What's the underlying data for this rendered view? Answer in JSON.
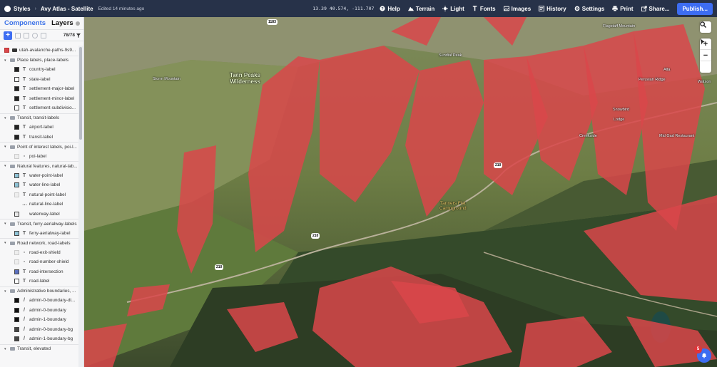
{
  "topbar": {
    "styles_label": "Styles",
    "separator": "›",
    "title": "Avy Atlas - Satellite",
    "edited": "Edited 14 minutes ago",
    "coords": "13.39  40.574, -111.707",
    "nav": [
      {
        "label": "Help",
        "icon": "help-icon"
      },
      {
        "label": "Terrain",
        "icon": "terrain-icon"
      },
      {
        "label": "Light",
        "icon": "light-icon"
      },
      {
        "label": "Fonts",
        "icon": "fonts-icon"
      },
      {
        "label": "Images",
        "icon": "images-icon"
      },
      {
        "label": "History",
        "icon": "history-icon"
      },
      {
        "label": "Settings",
        "icon": "settings-icon"
      },
      {
        "label": "Print",
        "icon": "print-icon"
      },
      {
        "label": "Share...",
        "icon": "share-icon"
      }
    ],
    "publish": "Publish..."
  },
  "sidebar": {
    "tab_components": "Components",
    "tab_layers": "Layers",
    "layer_count": "78/78",
    "root_layer": "utah-avalanche-paths-9s9...",
    "groups": [
      {
        "name": "Place labels, place-labels",
        "items": [
          {
            "label": "country-label",
            "color": "#222222",
            "type": "T"
          },
          {
            "label": "state-label",
            "color": "#ffffff",
            "type": "T"
          },
          {
            "label": "settlement-major-label",
            "color": "#222222",
            "type": "T"
          },
          {
            "label": "settlement-minor-label",
            "color": "#222222",
            "type": "T"
          },
          {
            "label": "settlement-subdivisio...",
            "color": "#ffffff",
            "type": "T"
          }
        ]
      },
      {
        "name": "Transit, transit-labels",
        "items": [
          {
            "label": "airport-label",
            "color": "#222222",
            "type": "T"
          },
          {
            "label": "transit-label",
            "color": "#222222",
            "type": "T"
          }
        ]
      },
      {
        "name": "Point of interest labels, poi-l...",
        "items": [
          {
            "label": "poi-label",
            "color": "",
            "type": "img"
          }
        ]
      },
      {
        "name": "Natural features, natural-lab...",
        "items": [
          {
            "label": "water-point-label",
            "color": "#8fc3d6",
            "type": "T"
          },
          {
            "label": "water-line-label",
            "color": "#8fc3d6",
            "type": "T"
          },
          {
            "label": "natural-point-label",
            "color": "",
            "type": "T"
          },
          {
            "label": "natural-line-label",
            "color": "",
            "type": "..."
          },
          {
            "label": "waterway-label",
            "color": "#e8e8e8",
            "type": ""
          }
        ]
      },
      {
        "name": "Transit, ferry-aerialway-labels",
        "items": [
          {
            "label": "ferry-aerialway-label",
            "color": "#8fc3d6",
            "type": "T"
          }
        ]
      },
      {
        "name": "Road network, road-labels",
        "items": [
          {
            "label": "road-exit-shield",
            "color": "",
            "type": "img"
          },
          {
            "label": "road-number-shield",
            "color": "",
            "type": "img"
          },
          {
            "label": "road-intersection",
            "color": "#5b6fbf",
            "type": "T"
          },
          {
            "label": "road-label",
            "color": "#ffffff",
            "type": "T"
          }
        ]
      },
      {
        "name": "Administrative boundaries, ...",
        "items": [
          {
            "label": "admin-0-boundary-di...",
            "color": "#111111",
            "type": "line"
          },
          {
            "label": "admin-0-boundary",
            "color": "#111111",
            "type": "line"
          },
          {
            "label": "admin-1-boundary",
            "color": "#111111",
            "type": "line"
          },
          {
            "label": "admin-0-boundary-bg",
            "color": "#444444",
            "type": "line"
          },
          {
            "label": "admin-1-boundary-bg",
            "color": "#444444",
            "type": "line"
          }
        ]
      },
      {
        "name": "Transit, elevated",
        "items": []
      }
    ]
  },
  "map": {
    "labels": {
      "wilderness": "Twin Peaks\nWilderness",
      "storm_mountain": "Storm Mountain",
      "sundial_peak": "Sundial Peak",
      "flagstaff": "Flagstaff Mountain",
      "snowbird": "Snowbird",
      "creekside": "Creekside",
      "lodge": "Lodge",
      "mid_gad": "Mid Gad Restaurant",
      "peruvian": "Peruvian Ridge",
      "watson": "Watson",
      "tanners": "Tanners Flat\nCampground",
      "alta": "Alta"
    },
    "shields": [
      "210",
      "210",
      "210",
      "1183"
    ],
    "notification_count": "5",
    "controls": [
      "search-icon",
      "zoom-in-icon",
      "zoom-out-icon",
      "compass-icon"
    ]
  },
  "colors": {
    "topbar": "#273249",
    "accent": "#3d6df2",
    "avalanche": "#d9474a"
  }
}
